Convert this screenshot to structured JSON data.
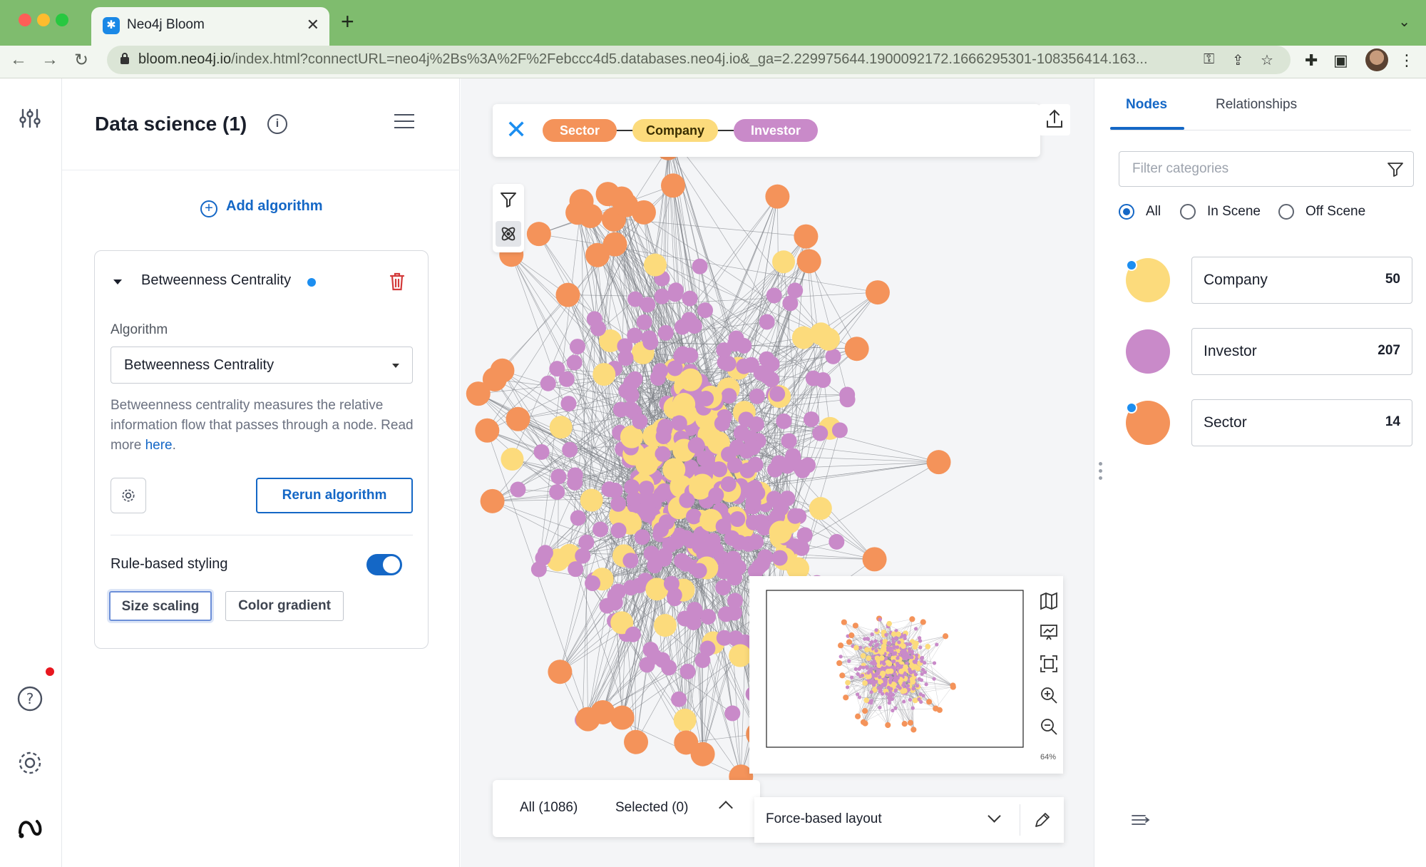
{
  "browser": {
    "tab_title": "Neo4j Bloom",
    "url_host": "bloom.neo4j.io",
    "url_rest": "/index.html?connectURL=neo4j%2Bs%3A%2F%2Febccc4d5.databases.neo4j.io&_ga=2.229975644.1900092172.1666295301-108356414.163..."
  },
  "ds_panel": {
    "title": "Data science (1)",
    "add_algorithm": "Add algorithm",
    "card": {
      "title": "Betweenness Centrality",
      "algorithm_label": "Algorithm",
      "algorithm_value": "Betweenness Centrality",
      "description": "Betweenness centrality measures the relative information flow that passes through a node. Read more",
      "link": "here",
      "rerun": "Rerun algorithm",
      "rule_styling": "Rule-based styling",
      "size_scaling": "Size scaling",
      "color_gradient": "Color gradient"
    }
  },
  "canvas": {
    "pills": [
      {
        "label": "Sector",
        "color": "#f4935a"
      },
      {
        "label": "Company",
        "color": "#fcdb7c"
      },
      {
        "label": "Investor",
        "color": "#c98ac9"
      }
    ],
    "all_count": "All (1086)",
    "selected_count": "Selected (0)",
    "layout": "Force-based layout",
    "zoom": "64%"
  },
  "right_panel": {
    "tab_nodes": "Nodes",
    "tab_relationships": "Relationships",
    "filter_placeholder": "Filter categories",
    "radio_all": "All",
    "radio_in": "In Scene",
    "radio_off": "Off Scene",
    "categories": [
      {
        "name": "Company",
        "count": "50",
        "color": "#fcdb7c",
        "marked": true
      },
      {
        "name": "Investor",
        "count": "207",
        "color": "#c98ac9",
        "marked": false
      },
      {
        "name": "Sector",
        "count": "14",
        "color": "#f4935a",
        "marked": true
      }
    ]
  },
  "colors": {
    "accent": "#1467c6",
    "company": "#fcdb7c",
    "investor": "#c98ac9",
    "sector": "#f4935a"
  }
}
